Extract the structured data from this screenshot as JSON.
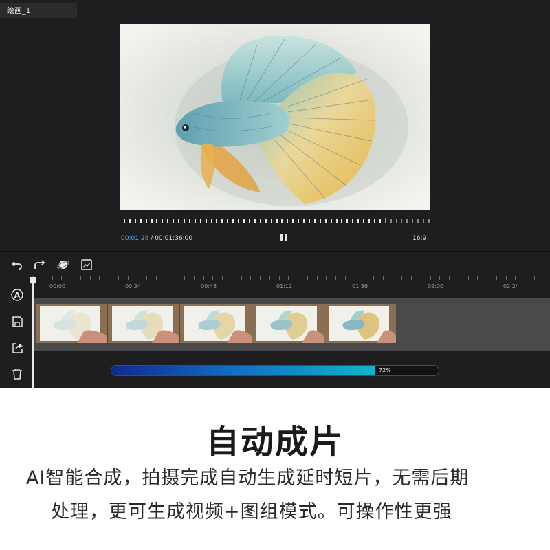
{
  "window": {
    "tab_label": "绘画_1"
  },
  "player": {
    "current_time": "00:01:28",
    "separator": " / ",
    "total_time": "00:01:36:00",
    "aspect_ratio": "16:9",
    "progress": 0.86,
    "state": "playing"
  },
  "toolbar": {
    "icons": [
      "undo-icon",
      "redo-icon",
      "planet-icon",
      "image-icon"
    ]
  },
  "side_tools": {
    "icons": [
      "ai-icon",
      "save-icon",
      "export-icon",
      "trash-icon"
    ]
  },
  "timeline": {
    "labels": [
      "00:00",
      "00:24",
      "00:48",
      "01:12",
      "01:36",
      "02:00",
      "02:24"
    ],
    "clip_count": 5
  },
  "render": {
    "progress": 0.72,
    "label": "72%"
  },
  "colors": {
    "accent": "#4fb0e8",
    "progress_start": "#0d2a8f",
    "progress_end": "#11b4c8"
  },
  "promo": {
    "title": "自动成片",
    "line1": "AI智能合成，拍摄完成自动生成延时短片，无需后期",
    "line2": "处理，更可生成视频+图组模式。可操作性更强"
  }
}
